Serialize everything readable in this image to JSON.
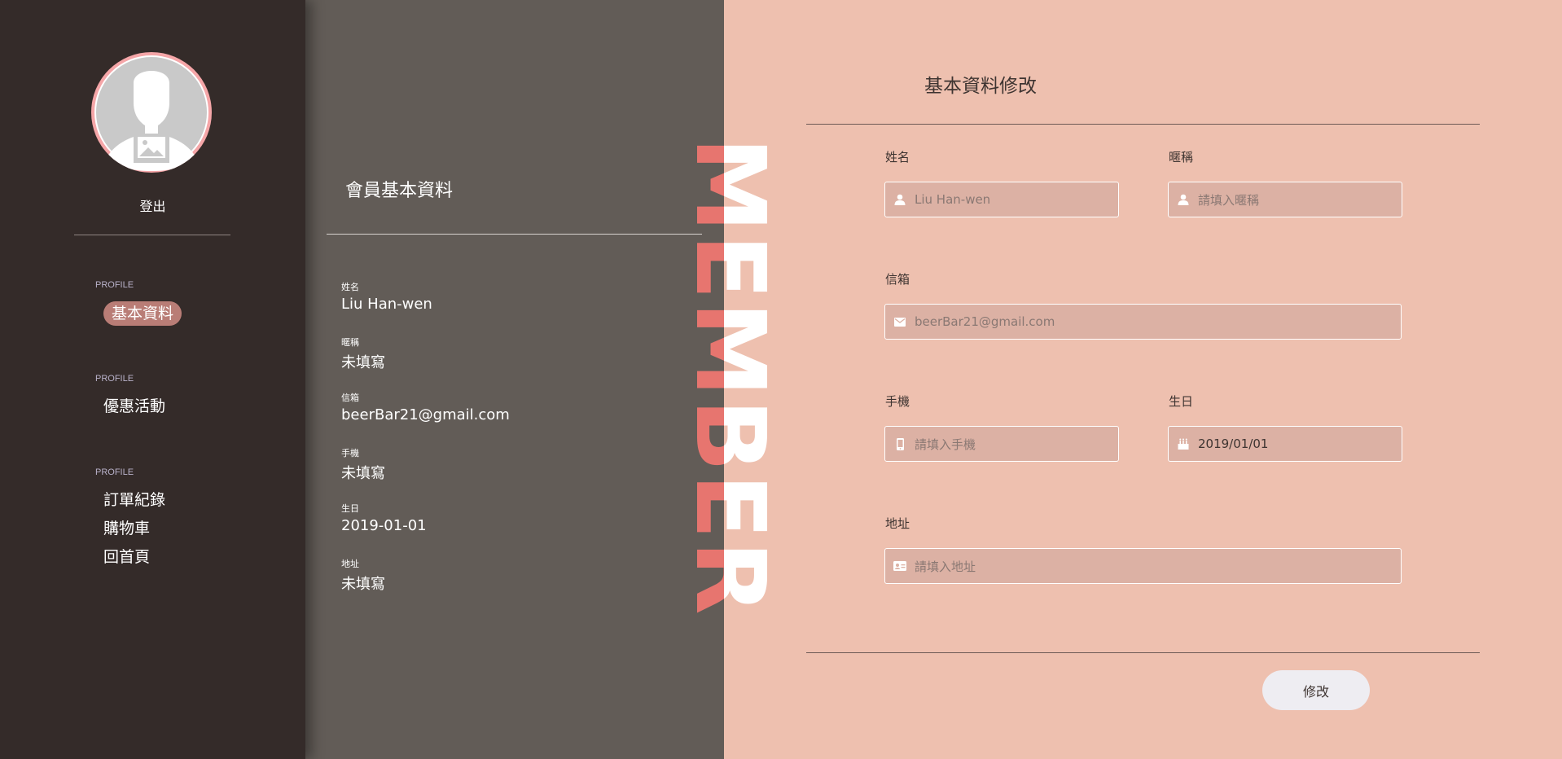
{
  "sidebar": {
    "logout_label": "登出",
    "groups": [
      {
        "label": "PROFILE",
        "items": [
          {
            "label": "基本資料",
            "active": true
          }
        ]
      },
      {
        "label": "PROFILE",
        "items": [
          {
            "label": "優惠活動"
          }
        ]
      },
      {
        "label": "PROFILE",
        "items": [
          {
            "label": "訂單紀錄"
          },
          {
            "label": "購物車"
          },
          {
            "label": "回首頁"
          }
        ]
      }
    ]
  },
  "info": {
    "title": "會員基本資料",
    "fields": [
      {
        "label": "姓名",
        "value": "Liu Han-wen"
      },
      {
        "label": "暱稱",
        "value": "未填寫"
      },
      {
        "label": "信箱",
        "value": "beerBar21@gmail.com"
      },
      {
        "label": "手機",
        "value": "未填寫"
      },
      {
        "label": "生日",
        "value": "2019-01-01"
      },
      {
        "label": "地址",
        "value": "未填寫"
      }
    ]
  },
  "decor": {
    "vertical_word": "MEMBER"
  },
  "form": {
    "title": "基本資料修改",
    "name": {
      "label": "姓名",
      "placeholder": "Liu Han-wen",
      "icon": "user-icon"
    },
    "nickname": {
      "label": "暱稱",
      "placeholder": "請填入暱稱",
      "icon": "user-icon"
    },
    "email": {
      "label": "信箱",
      "placeholder": "beerBar21@gmail.com",
      "icon": "envelope-icon"
    },
    "phone": {
      "label": "手機",
      "placeholder": "請填入手機",
      "icon": "mobile-icon"
    },
    "birthday": {
      "label": "生日",
      "value": "2019/01/01",
      "icon": "cake-icon"
    },
    "address": {
      "label": "地址",
      "placeholder": "請填入地址",
      "icon": "id-card-icon"
    },
    "submit_label": "修改"
  },
  "colors": {
    "sidebar_bg": "#342b29",
    "info_bg": "#625c57",
    "form_bg": "#eec0af",
    "accent": "#e7756f",
    "active_pill": "#b97d76"
  }
}
